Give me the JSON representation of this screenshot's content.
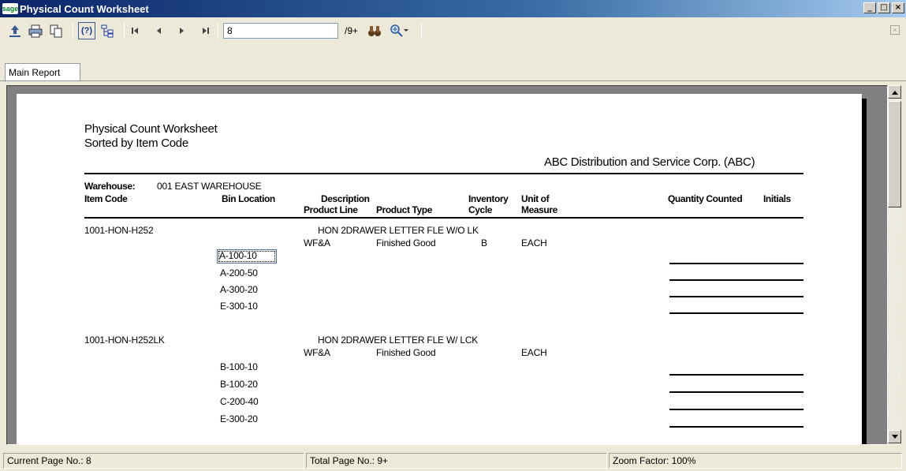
{
  "window": {
    "logo": "sage",
    "title": "Physical Count Worksheet",
    "controls": [
      "minimize",
      "maximize",
      "close"
    ]
  },
  "toolbar": {
    "icons": [
      "export-icon",
      "print-icon",
      "copy-icon",
      "help-icon",
      "group-tree-icon"
    ],
    "nav": [
      "first-page",
      "previous-page",
      "next-page",
      "last-page"
    ],
    "page_value": "8",
    "page_total": "/9+",
    "search_icon": "binoculars-icon",
    "zoom_icon": "zoom-icon"
  },
  "tabs": {
    "main": "Main Report"
  },
  "report": {
    "title": "Physical Count Worksheet",
    "subtitle": "Sorted by Item Code",
    "company": "ABC Distribution and Service Corp. (ABC)",
    "warehouse_label": "Warehouse:",
    "warehouse_value": "001  EAST WAREHOUSE",
    "headers": {
      "item_code": "Item Code",
      "bin_location": "Bin Location",
      "description": "Description",
      "product_line": "Product Line",
      "product_type": "Product Type",
      "inventory": "Inventory",
      "cycle": "Cycle",
      "unit_of": "Unit of",
      "measure": "Measure",
      "quantity_counted": "Quantity Counted",
      "initials": "Initials"
    },
    "items": [
      {
        "code": "1001-HON-H252",
        "description": "HON 2DRAWER LETTER FLE W/O LK",
        "product_line": "WF&A",
        "product_type": "Finished Good",
        "cycle": "B",
        "unit": "EACH",
        "bins": [
          "A-100-10",
          "A-200-50",
          "A-300-20",
          "E-300-10"
        ]
      },
      {
        "code": "1001-HON-H252LK",
        "description": "HON 2DRAWER LETTER FLE W/ LCK",
        "product_line": "WF&A",
        "product_type": "Finished Good",
        "cycle": "",
        "unit": "EACH",
        "bins": [
          "B-100-10",
          "B-100-20",
          "C-200-40",
          "E-300-20"
        ]
      }
    ]
  },
  "status": {
    "current_page": "Current Page No.: 8",
    "total_page": "Total Page No.: 9+",
    "zoom": "Zoom Factor: 100%"
  }
}
